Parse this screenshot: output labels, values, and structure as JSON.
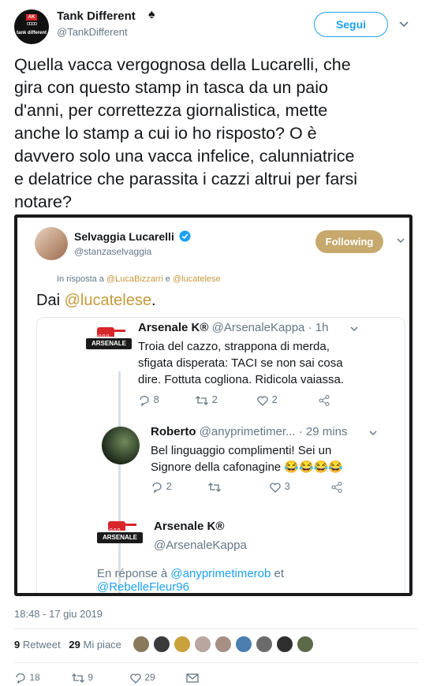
{
  "header": {
    "display_name": "Tank Different",
    "spade": "♠",
    "handle": "@TankDifferent",
    "follow_label": "Segui",
    "avatar_text": {
      "top": "AK",
      "middle": "ᴼᴼᴼᴼ",
      "bottom": "tank different"
    }
  },
  "tweet": {
    "text": "Quella vacca vergognosa della Lucarelli, che\ngira con questo stamp in tasca da un paio\nd'anni, per correttezza giornalistica, mette\nanche lo  stamp a cui io ho risposto? O è\ndavvero solo una vacca infelice, calunniatrice\ne delatrice che parassita i cazzi altrui per farsi\nnotare?"
  },
  "embed": {
    "display_name": "Selvaggia Lucarelli",
    "handle": "@stanzaselvaggia",
    "following_label": "Following",
    "reply_prefix": "In risposta a",
    "reply_to_1": "@LucaBizzarri",
    "reply_and": "e",
    "reply_to_2": "@lucatelese",
    "text_prefix": "Dai",
    "text_mention": "@lucatelese",
    "text_suffix": ".",
    "thread": {
      "first": {
        "name": "Arsenale K®",
        "meta": "@ArsenaleKappa · 1h",
        "text": "Troia del cazzo, strappona di merda,\nsfigata disperata: TACI se non sai cosa\ndire. Fottuta cogliona. Ridicola vaiassa.",
        "replies": "8",
        "retweets": "2",
        "likes": "2"
      },
      "second": {
        "name": "Roberto",
        "meta": "@anyprimetimer... · 29 mins",
        "text": "Bel linguaggio complimenti!  Sei un\nSignore della cafonagine 😂😂😂😂",
        "replies": "2",
        "retweets": "",
        "likes": "3"
      },
      "third": {
        "name": "Arsenale K®",
        "handle": "@ArsenaleKappa",
        "reply_prefix": "En réponse à",
        "reply_to_1": "@anyprimetimerob",
        "reply_and": "et",
        "reply_to_2": "@RebelleFleur96"
      },
      "logo_text": "ARSENALE"
    }
  },
  "meta": {
    "timestamp": "18:48 - 17 giu 2019",
    "retweet_count": "9",
    "retweet_label": "Retweet",
    "like_count": "29",
    "like_label": "Mi piace"
  },
  "likers_colors": [
    "#8a7a5c",
    "#3a3a3a",
    "#c9a23b",
    "#b9a6a0",
    "#a88f86",
    "#4a7fb0",
    "#6b6b6b",
    "#2f2f2f",
    "#5b6b4a"
  ],
  "actions": {
    "replies": "18",
    "retweets": "9",
    "likes": "29"
  },
  "colors": {
    "accent": "#1da1f2",
    "gold": "#c7a96d",
    "text": "#14171a",
    "muted": "#657786"
  }
}
